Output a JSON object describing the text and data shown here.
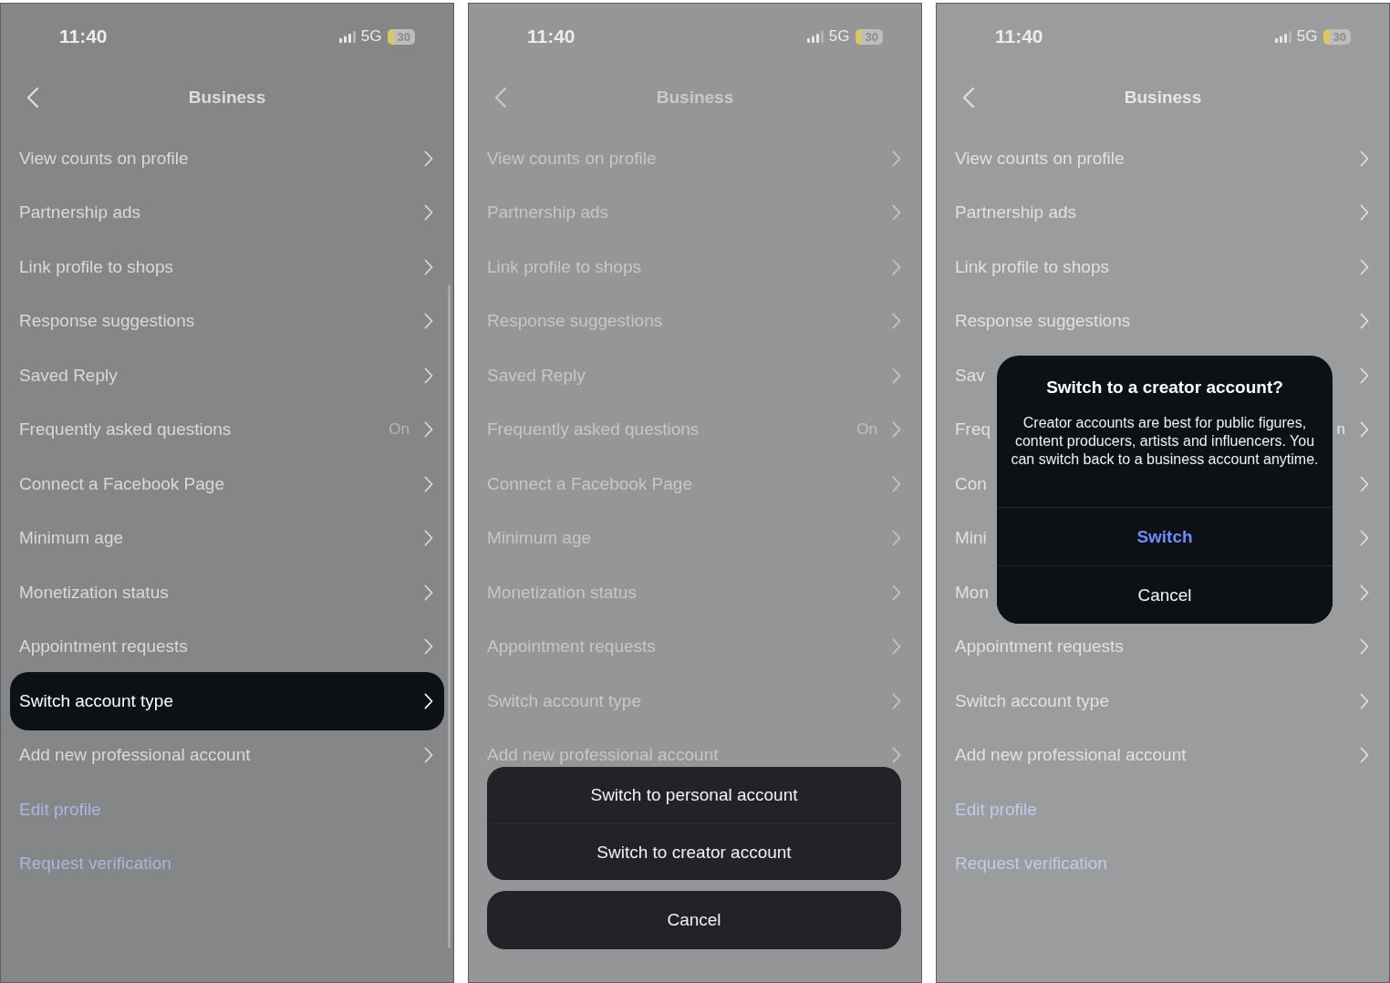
{
  "screens": [
    {
      "kind": "list",
      "status": {
        "time": "11:40",
        "network": "5G",
        "battery": "30"
      },
      "title": "Business",
      "rows": [
        {
          "kind": "setting",
          "label": "View counts on profile",
          "selected": false
        },
        {
          "kind": "setting",
          "label": "Partnership ads",
          "selected": false
        },
        {
          "kind": "setting",
          "label": "Link profile to shops",
          "selected": false
        },
        {
          "kind": "setting",
          "label": "Response suggestions",
          "selected": false
        },
        {
          "kind": "setting",
          "label": "Saved Reply",
          "selected": false
        },
        {
          "kind": "setting",
          "label": "Frequently asked questions",
          "value": "On",
          "selected": false
        },
        {
          "kind": "setting",
          "label": "Connect a Facebook Page",
          "selected": false
        },
        {
          "kind": "setting",
          "label": "Minimum age",
          "selected": false
        },
        {
          "kind": "setting",
          "label": "Monetization status",
          "selected": false
        },
        {
          "kind": "setting",
          "label": "Appointment requests",
          "selected": false
        },
        {
          "kind": "setting",
          "label": "Switch account type",
          "selected": true
        },
        {
          "kind": "setting",
          "label": "Add new professional account",
          "selected": false
        },
        {
          "kind": "link",
          "label": "Edit profile",
          "selected": false
        },
        {
          "kind": "link",
          "label": "Request verification",
          "selected": false
        }
      ]
    },
    {
      "kind": "sheet",
      "status": {
        "time": "11:40",
        "network": "5G",
        "battery": "30"
      },
      "title": "Business",
      "rows": [
        {
          "kind": "setting",
          "label": "View counts on profile",
          "selected": false
        },
        {
          "kind": "setting",
          "label": "Partnership ads",
          "selected": false
        },
        {
          "kind": "setting",
          "label": "Link profile to shops",
          "selected": false
        },
        {
          "kind": "setting",
          "label": "Response suggestions",
          "selected": false
        },
        {
          "kind": "setting",
          "label": "Saved Reply",
          "selected": false
        },
        {
          "kind": "setting",
          "label": "Frequently asked questions",
          "value": "On",
          "selected": false
        },
        {
          "kind": "setting",
          "label": "Connect a Facebook Page",
          "selected": false
        },
        {
          "kind": "setting",
          "label": "Minimum age",
          "selected": false
        },
        {
          "kind": "setting",
          "label": "Monetization status",
          "selected": false
        },
        {
          "kind": "setting",
          "label": "Appointment requests",
          "selected": false
        },
        {
          "kind": "setting",
          "label": "Switch account type",
          "selected": false
        },
        {
          "kind": "setting",
          "label": "Add new professional account",
          "selected": false
        }
      ],
      "sheet": {
        "options": [
          "Switch to personal account",
          "Switch to creator account"
        ],
        "cancel": "Cancel"
      }
    },
    {
      "kind": "dialog",
      "status": {
        "time": "11:40",
        "network": "5G",
        "battery": "30"
      },
      "title": "Business",
      "rows": [
        {
          "kind": "setting",
          "label": "View counts on profile",
          "selected": false
        },
        {
          "kind": "setting",
          "label": "Partnership ads",
          "selected": false
        },
        {
          "kind": "setting",
          "label": "Link profile to shops",
          "selected": false
        },
        {
          "kind": "setting",
          "label": "Response suggestions",
          "selected": false
        },
        {
          "kind": "setting",
          "label": "Sav",
          "selected": false
        },
        {
          "kind": "setting",
          "label": "Freq",
          "value": "n",
          "selected": false
        },
        {
          "kind": "setting",
          "label": "Con",
          "selected": false
        },
        {
          "kind": "setting",
          "label": "Mini",
          "selected": false
        },
        {
          "kind": "setting",
          "label": "Mon",
          "selected": false
        },
        {
          "kind": "setting",
          "label": "Appointment requests",
          "selected": false
        },
        {
          "kind": "setting",
          "label": "Switch account type",
          "selected": false
        },
        {
          "kind": "setting",
          "label": "Add new professional account",
          "selected": false
        },
        {
          "kind": "link",
          "label": "Edit profile",
          "selected": false
        },
        {
          "kind": "link",
          "label": "Request verification",
          "selected": false
        }
      ],
      "dialog": {
        "title": "Switch to a creator account?",
        "message": "Creator accounts are best for public figures, content producers, artists and influencers. You can switch back to a business account anytime.",
        "buttons": [
          {
            "kind": "primary",
            "label": "Switch"
          },
          {
            "kind": "cancel",
            "label": "Cancel"
          }
        ]
      }
    }
  ]
}
